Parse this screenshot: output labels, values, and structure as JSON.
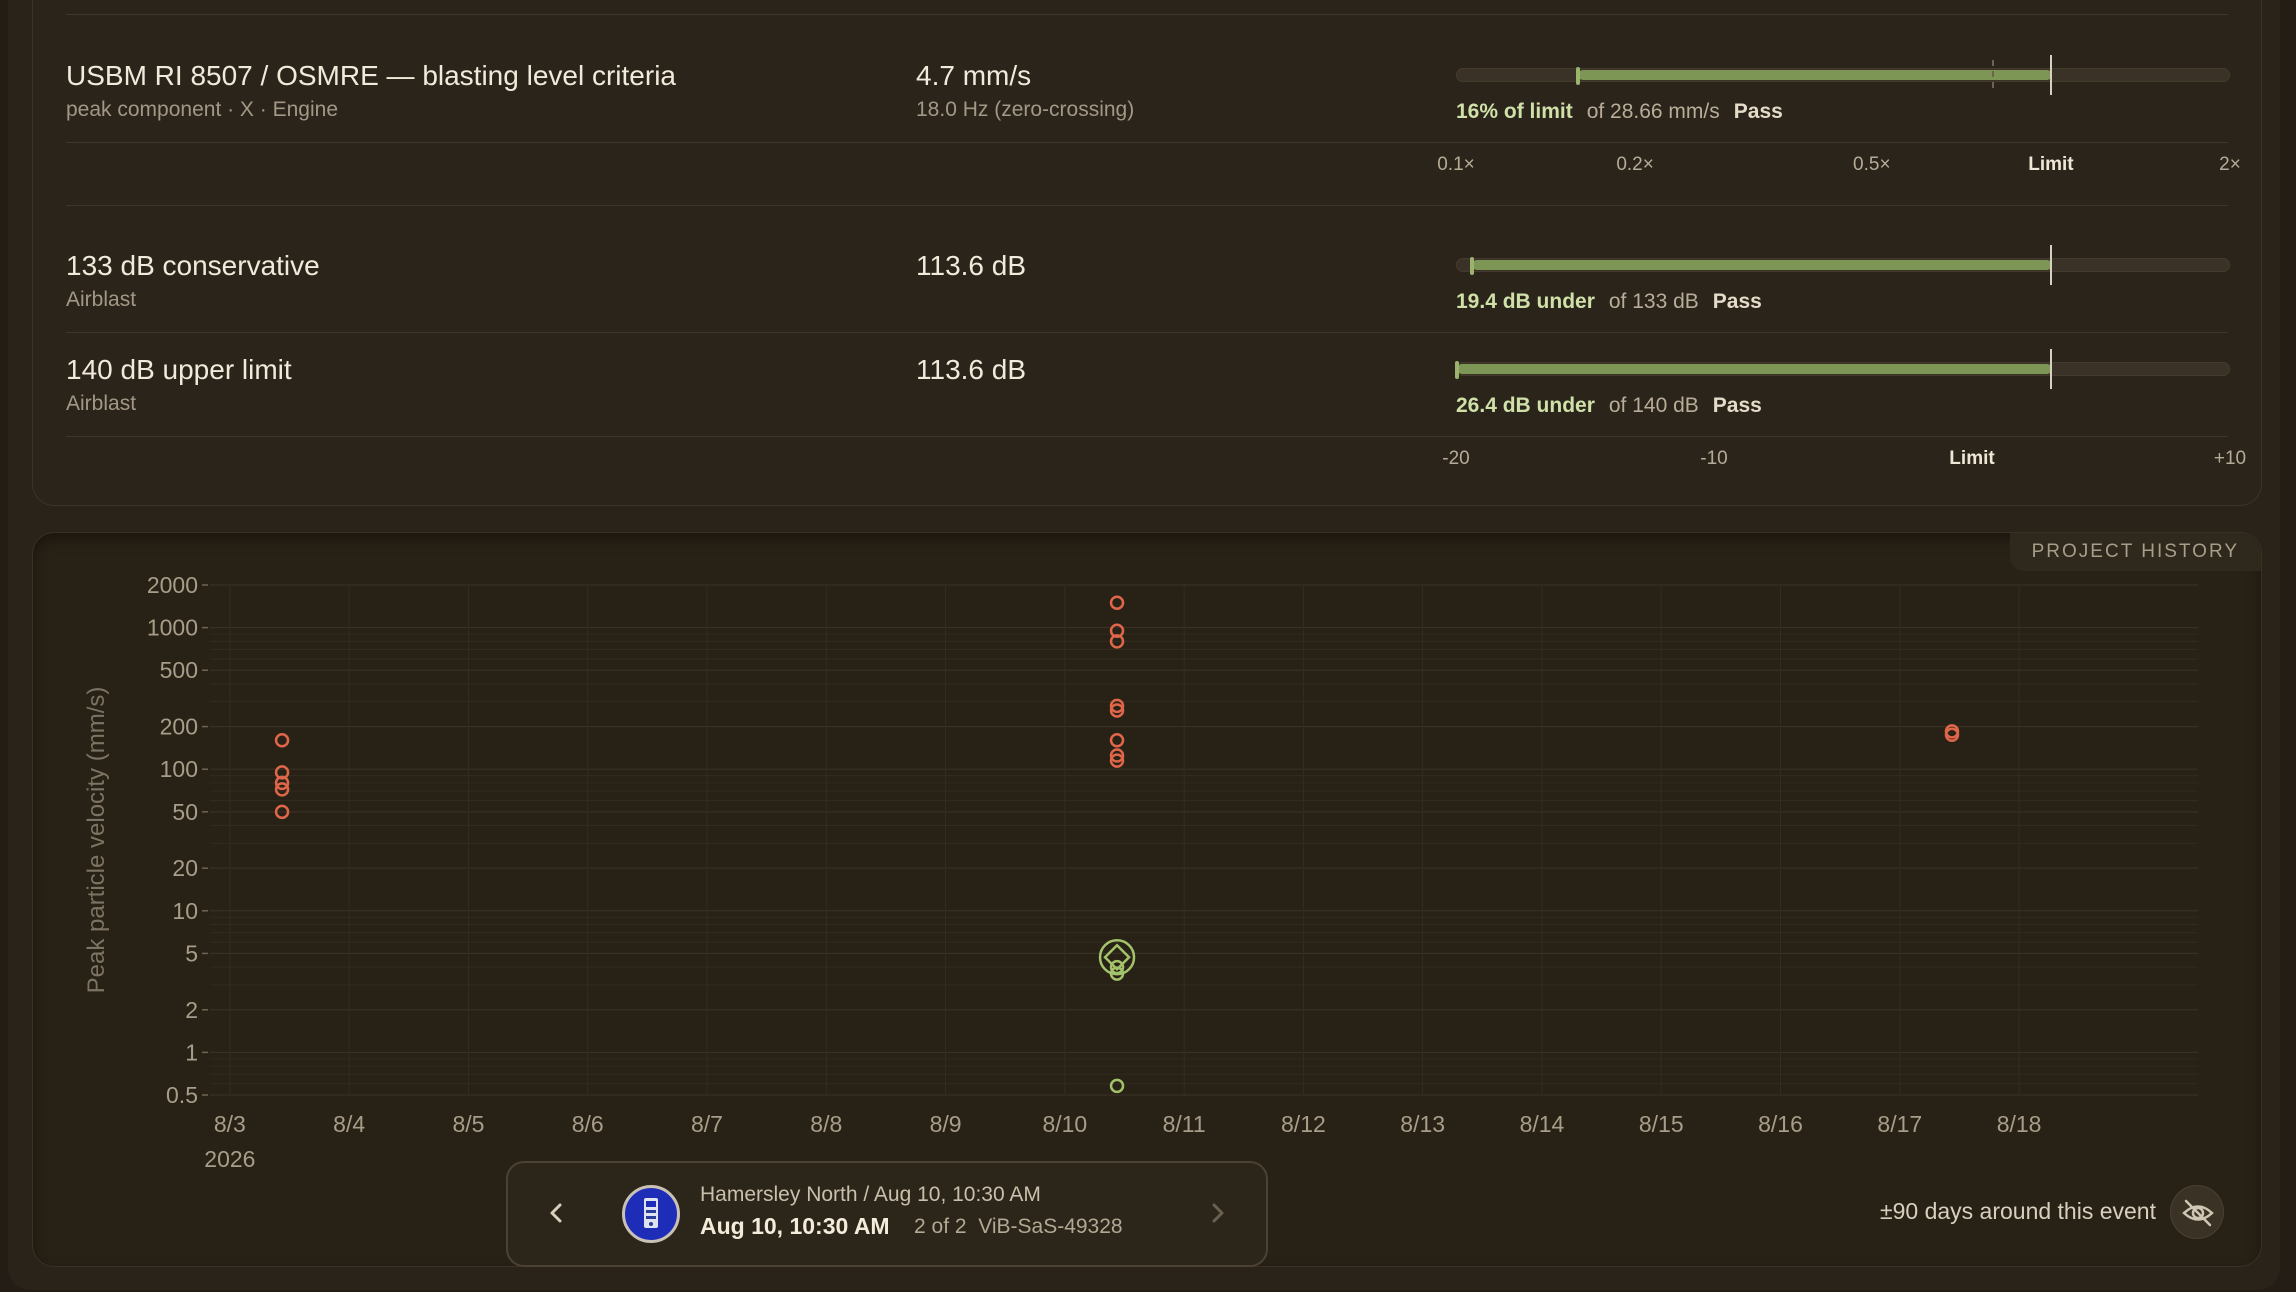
{
  "criteria": [
    {
      "name": "USBM RI 8507 / OSMRE — blasting level criteria",
      "sub": "peak component · X · Engine",
      "value": "4.7 mm/s",
      "value_sub": "18.0 Hz (zero-crossing)",
      "ratio_text": "16% of limit",
      "of_text": "of 28.66 mm/s",
      "status": "Pass",
      "ratio": 0.16
    },
    {
      "name": "133 dB conservative",
      "sub": "Airblast",
      "value": "113.6 dB",
      "ratio_text": "19.4 dB under",
      "of_text": "of 133 dB",
      "status": "Pass",
      "delta_db": -19.4
    },
    {
      "name": "140 dB upper limit",
      "sub": "Airblast",
      "value": "113.6 dB",
      "ratio_text": "26.4 dB under",
      "of_text": "of 140 dB",
      "status": "Pass",
      "delta_db": -26.4
    }
  ],
  "ratio_scale": [
    "0.1×",
    "0.2×",
    "0.5×",
    "Limit",
    "2×"
  ],
  "db_scale": [
    "-20",
    "-10",
    "Limit",
    "+10"
  ],
  "history": {
    "tag": "PROJECT HISTORY",
    "range_label": "±90 days around this event"
  },
  "event_nav": {
    "title": "Hamersley North / Aug 10, 10:30 AM",
    "date": "Aug 10, 10:30 AM",
    "position": "2 of 2",
    "device": "ViB-SaS-49328"
  },
  "colors": {
    "pass_green": "#7e9655",
    "other_event": "#e0664a",
    "this_event": "#a3c26a"
  },
  "chart_data": {
    "type": "scatter",
    "ylabel": "Peak particle velocity (mm/s)",
    "y_scale": "log",
    "ylim": [
      0.5,
      2000
    ],
    "y_ticks": [
      2000,
      1000,
      500,
      200,
      100,
      50,
      20,
      10,
      5,
      2,
      1,
      0.5
    ],
    "x_ticks": [
      "8/3",
      "8/4",
      "8/5",
      "8/6",
      "8/7",
      "8/8",
      "8/9",
      "8/10",
      "8/11",
      "8/12",
      "8/13",
      "8/14",
      "8/15",
      "8/16",
      "8/17",
      "8/18"
    ],
    "x_year": "2026",
    "xlim": [
      "2026-08-02T20:00",
      "2026-08-19T12:00"
    ],
    "series": [
      {
        "role": "other",
        "points": [
          {
            "x": "2026-08-03T10:30",
            "y": 160
          },
          {
            "x": "2026-08-03T10:30",
            "y": 95
          },
          {
            "x": "2026-08-03T10:30",
            "y": 80
          },
          {
            "x": "2026-08-03T10:30",
            "y": 72
          },
          {
            "x": "2026-08-03T10:30",
            "y": 50
          },
          {
            "x": "2026-08-10T10:30",
            "y": 1500
          },
          {
            "x": "2026-08-10T10:30",
            "y": 950
          },
          {
            "x": "2026-08-10T10:30",
            "y": 800
          },
          {
            "x": "2026-08-10T10:30",
            "y": 280
          },
          {
            "x": "2026-08-10T10:30",
            "y": 260
          },
          {
            "x": "2026-08-10T10:30",
            "y": 160
          },
          {
            "x": "2026-08-10T10:30",
            "y": 125
          },
          {
            "x": "2026-08-10T10:30",
            "y": 115
          },
          {
            "x": "2026-08-17T10:30",
            "y": 185
          },
          {
            "x": "2026-08-17T10:30",
            "y": 175
          }
        ]
      },
      {
        "role": "this-event",
        "points": [
          {
            "x": "2026-08-10T10:30",
            "y": 4.7,
            "selected": true
          },
          {
            "x": "2026-08-10T10:30",
            "y": 4.0
          },
          {
            "x": "2026-08-10T10:30",
            "y": 3.6
          },
          {
            "x": "2026-08-10T10:30",
            "y": 0.58
          }
        ]
      }
    ]
  }
}
